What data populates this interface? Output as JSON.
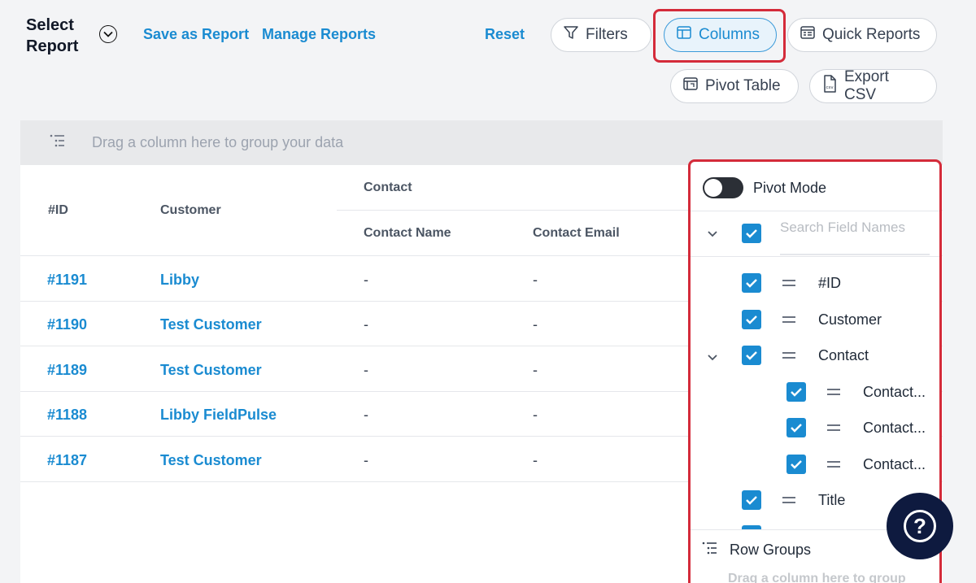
{
  "toolbar": {
    "select_report": "Select Report",
    "save_as_report": "Save as Report",
    "manage_reports": "Manage Reports",
    "reset": "Reset",
    "filters": "Filters",
    "columns": "Columns",
    "quick_reports": "Quick Reports",
    "pivot_table": "Pivot Table",
    "export_csv": "Export CSV"
  },
  "grid": {
    "group_placeholder": "Drag a column here to group your data",
    "headers": {
      "id": "#ID",
      "customer": "Customer",
      "contact_group": "Contact",
      "contact_name": "Contact Name",
      "contact_email": "Contact Email"
    },
    "rows": [
      {
        "id": "#1191",
        "customer": "Libby",
        "contact_name": "-",
        "contact_email": "-"
      },
      {
        "id": "#1190",
        "customer": "Test Customer",
        "contact_name": "-",
        "contact_email": "-"
      },
      {
        "id": "#1189",
        "customer": "Test Customer",
        "contact_name": "-",
        "contact_email": "-"
      },
      {
        "id": "#1188",
        "customer": "Libby FieldPulse",
        "contact_name": "-",
        "contact_email": "-"
      },
      {
        "id": "#1187",
        "customer": "Test Customer",
        "contact_name": "-",
        "contact_email": "-"
      }
    ]
  },
  "panel": {
    "pivot_mode": "Pivot Mode",
    "search_placeholder": "Search Field Names",
    "fields": [
      {
        "label": "#ID",
        "checked": true
      },
      {
        "label": "Customer",
        "checked": true
      },
      {
        "label": "Contact",
        "checked": true
      },
      {
        "label": "Contact...",
        "checked": true
      },
      {
        "label": "Contact...",
        "checked": true
      },
      {
        "label": "Contact...",
        "checked": true
      },
      {
        "label": "Title",
        "checked": true
      }
    ],
    "row_groups": "Row Groups",
    "row_groups_hint": "Drag a column here to group"
  },
  "help": {
    "label": "?"
  },
  "colors": {
    "accent": "#1a8bd1",
    "highlight": "#d42b3a",
    "help_bg": "#0e1a3f"
  }
}
